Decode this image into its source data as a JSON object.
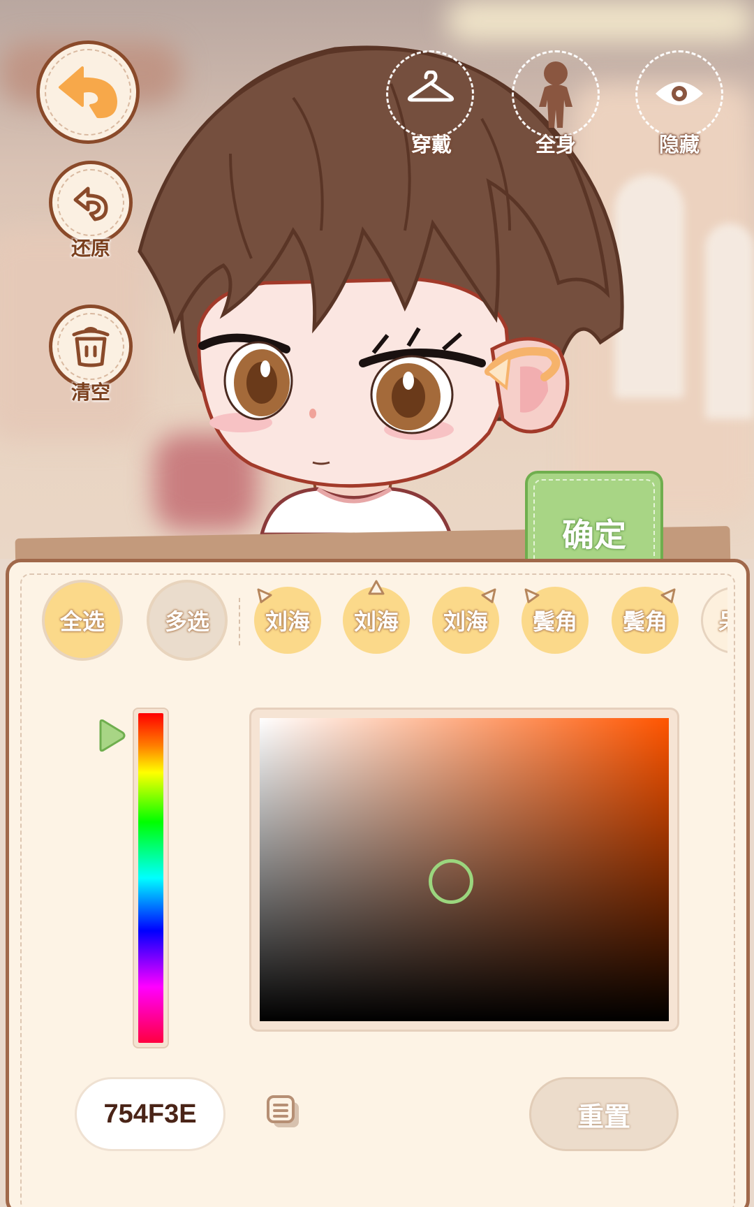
{
  "left_buttons": {
    "restore_label": "还原",
    "clear_label": "清空"
  },
  "top_buttons": {
    "wear_label": "穿戴",
    "fullbody_label": "全身",
    "hide_label": "隐藏"
  },
  "confirm_label": "确定",
  "parts": {
    "select_all": "全选",
    "multi_select": "多选",
    "items": [
      {
        "label": "刘海",
        "mark": "left"
      },
      {
        "label": "刘海",
        "mark": "top"
      },
      {
        "label": "刘海",
        "mark": "right"
      },
      {
        "label": "鬓角",
        "mark": "left"
      },
      {
        "label": "鬓角",
        "mark": "right"
      },
      {
        "label": "呆"
      }
    ]
  },
  "color_picker": {
    "hex_value": "754F3E",
    "hue_color": "#ff5500",
    "reset_label": "重置"
  },
  "colors": {
    "hair": "#754F3E",
    "confirm_green": "#a8d585",
    "chip_yellow": "#fbd98a"
  }
}
